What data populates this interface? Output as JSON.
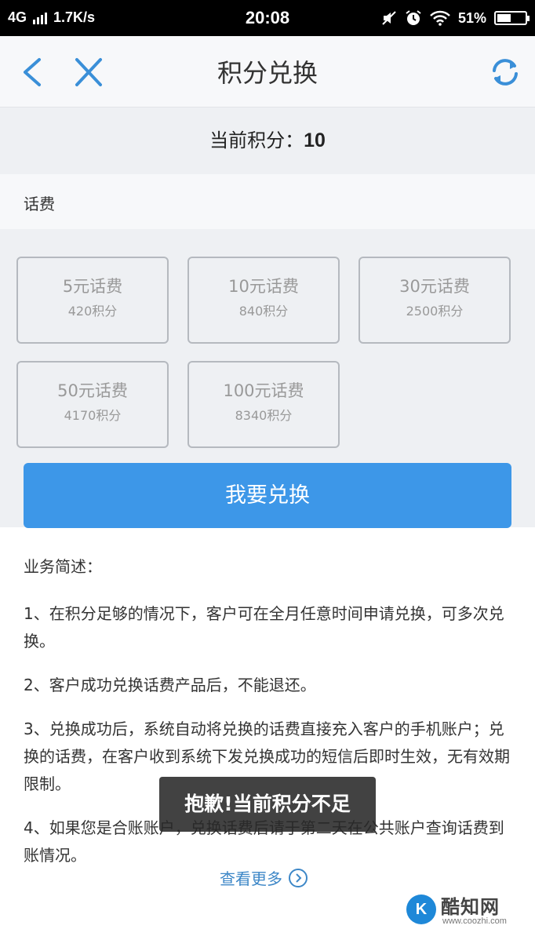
{
  "status_bar": {
    "network": "4G",
    "speed": "1.7K/s",
    "time": "20:08",
    "battery": "51%",
    "battery_level": 0.51,
    "icons": [
      "signal-icon",
      "mute-icon",
      "alarm-icon",
      "wifi-icon",
      "battery-icon"
    ]
  },
  "navbar": {
    "title": "积分兑换",
    "icons": [
      "back-icon",
      "close-icon",
      "refresh-icon"
    ]
  },
  "points": {
    "label": "当前积分：",
    "value": "10"
  },
  "section": {
    "label": "话费"
  },
  "options": [
    {
      "title": "5元话费",
      "points": "420积分"
    },
    {
      "title": "10元话费",
      "points": "840积分"
    },
    {
      "title": "30元话费",
      "points": "2500积分"
    },
    {
      "title": "50元话费",
      "points": "4170积分"
    },
    {
      "title": "100元话费",
      "points": "8340积分"
    }
  ],
  "submit_button": {
    "label": "我要兑换"
  },
  "description": {
    "heading": "业务简述：",
    "items": [
      "1、在积分足够的情况下，客户可在全月任意时间申请兑换，可多次兑换。",
      "2、客户成功兑换话费产品后，不能退还。",
      "3、兑换成功后，系统自动将兑换的话费直接充入客户的手机账户；兑换的话费，在客户收到系统下发兑换成功的短信后即时生效，无有效期限制。",
      "4、如果您是合账账户，兑换话费后请于第二天在公共账户查询话费到账情况。"
    ]
  },
  "more_link": {
    "label": "查看更多"
  },
  "toast": {
    "message": "抱歉!当前积分不足"
  },
  "watermark": {
    "name": "酷知网",
    "url": "www.coozhi.com"
  },
  "colors": {
    "primary_button": "#3d97e8",
    "link": "#3d87c7",
    "nav_icon": "#3a8fd8",
    "page_bg": "#eef0f3"
  }
}
